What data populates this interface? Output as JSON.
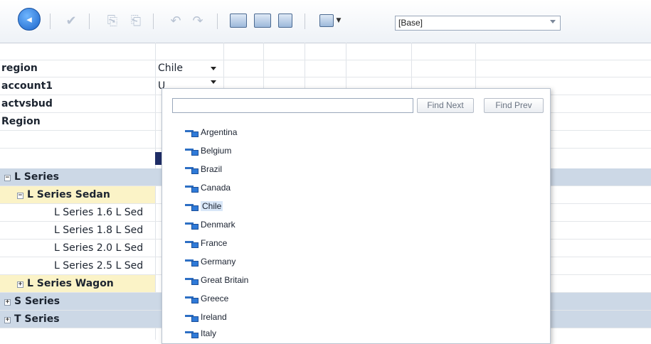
{
  "toolbar": {
    "circle_icon": "arrow-circle-icon",
    "base_combo_value": "[Base]",
    "colors": {
      "circle": "#1a63c9"
    }
  },
  "grid": {
    "pov": [
      {
        "label": "region",
        "value": "Chile"
      },
      {
        "label": "account1",
        "value": "Units"
      },
      {
        "label": "actvsbud",
        "value": ""
      },
      {
        "label": "Region",
        "value": ""
      }
    ],
    "tree": [
      {
        "label": "L Series",
        "expander": "⊟",
        "bold": true,
        "indent": 0,
        "style": "series"
      },
      {
        "label": "L Series Sedan",
        "expander": "⊟",
        "bold": true,
        "indent": 1,
        "style": "sedan"
      },
      {
        "label": "L Series 1.6 L Sed",
        "expander": "",
        "bold": false,
        "indent": 2,
        "style": ""
      },
      {
        "label": "L Series 1.8 L Sed",
        "expander": "",
        "bold": false,
        "indent": 2,
        "style": ""
      },
      {
        "label": "L Series 2.0 L Sed",
        "expander": "",
        "bold": false,
        "indent": 2,
        "style": ""
      },
      {
        "label": "L Series 2.5 L Sed",
        "expander": "",
        "bold": false,
        "indent": 2,
        "style": ""
      },
      {
        "label": "L Series Wagon",
        "expander": "⊞",
        "bold": true,
        "indent": 1,
        "style": "sedan"
      },
      {
        "label": "S Series",
        "expander": "⊞",
        "bold": true,
        "indent": 0,
        "style": "series"
      },
      {
        "label": "T Series",
        "expander": "⊞",
        "bold": true,
        "indent": 0,
        "style": "series"
      }
    ]
  },
  "popup": {
    "search_value": "",
    "find_next": "Find Next",
    "find_prev": "Find Prev",
    "members": [
      "Argentina",
      "Belgium",
      "Brazil",
      "Canada",
      "Chile",
      "Denmark",
      "France",
      "Germany",
      "Great Britain",
      "Greece",
      "Ireland",
      "Italy"
    ],
    "selected": "Chile"
  }
}
